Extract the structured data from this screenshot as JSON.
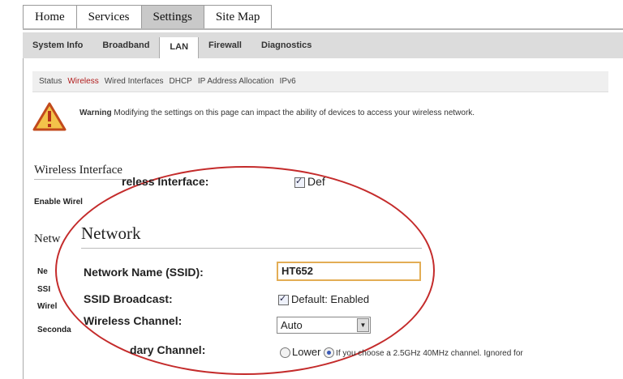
{
  "top_tabs": [
    "Home",
    "Services",
    "Settings",
    "Site Map"
  ],
  "sub_tabs": [
    "System Info",
    "Broadband",
    "LAN",
    "Firewall",
    "Diagnostics"
  ],
  "section_nav": [
    "Status",
    "Wireless",
    "Wired Interfaces",
    "DHCP",
    "IP Address Allocation",
    "IPv6"
  ],
  "warning": {
    "title": "Warning",
    "text": "Modifying the settings on this page can impact the ability of devices to access your wireless network."
  },
  "background": {
    "wireless_heading": "Wireless Interface",
    "enable_label": "Enable Wirel",
    "network_heading": "Netw",
    "row_fragments": [
      "Ne",
      "SSI",
      "Wirel",
      "Seconda"
    ]
  },
  "zoom": {
    "wireless_interface_label": "reless Interface:",
    "default_label": "Def",
    "network_heading": "Network",
    "ssid_label": "Network Name (SSID):",
    "ssid_value": "HT652",
    "broadcast_label": "SSID Broadcast:",
    "broadcast_value": "Default: Enabled",
    "channel_label": "Wireless Channel:",
    "channel_value": "Auto",
    "secondary_label": "dary Channel:",
    "secondary_lower": "Lower",
    "secondary_note": "If you choose a 2.5GHz 40MHz channel. Ignored for"
  },
  "colors": {
    "active_section": "#b11c1c",
    "ellipse": "#c42b2b",
    "ssid_border": "#e3ad55"
  }
}
